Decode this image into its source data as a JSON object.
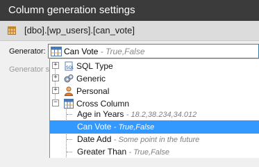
{
  "window": {
    "title": "Column generation settings"
  },
  "column": {
    "path": "[dbo].[wp_users].[can_vote]"
  },
  "generator": {
    "label": "Generator:",
    "selected_name": "Can Vote",
    "selected_sample": "- True,False",
    "settings_label": "Generator s"
  },
  "tree": {
    "categories": [
      {
        "label": "SQL Type",
        "expander": "+"
      },
      {
        "label": "Generic",
        "expander": "+"
      },
      {
        "label": "Personal",
        "expander": "+"
      },
      {
        "label": "Cross Column",
        "expander": "−"
      }
    ],
    "items": [
      {
        "name": "Age in Years",
        "sample": "- 18.2,38.234,34.012"
      },
      {
        "name": "Can Vote",
        "sample": "- True,False",
        "selected": true
      },
      {
        "name": "Date Add",
        "sample": "- Some point in the future"
      },
      {
        "name": "Greater Than",
        "sample": "- True,False"
      }
    ]
  },
  "colors": {
    "selection": "#3399ff",
    "title_bar": "#3b3b3b",
    "combo_border": "#3c7fb1"
  }
}
